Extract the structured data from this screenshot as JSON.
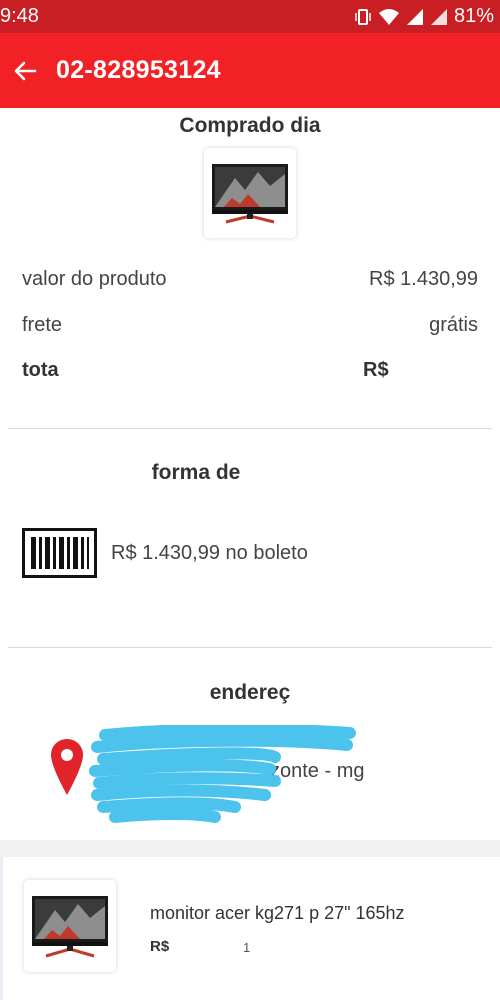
{
  "status": {
    "time": "9:48",
    "battery": "81%"
  },
  "header": {
    "title": "02-828953124",
    "color": "#f22126"
  },
  "purchase": {
    "heading": "Comprado dia",
    "product_value_label": "valor do produto",
    "product_value": "R$ 1.430,99",
    "shipping_label": "frete",
    "shipping_value": "grátis",
    "total_label": "tota",
    "total_value": "R$"
  },
  "payment": {
    "heading": "forma de",
    "icon": "barcode-icon",
    "text": "R$ 1.430,99 no boleto"
  },
  "address": {
    "heading": "endereç",
    "icon": "location-pin-icon",
    "visible_text": "zonte - mg"
  },
  "item": {
    "name": "monitor acer kg271 p 27\" 165hz",
    "price_label": "R$",
    "quantity": "1"
  }
}
